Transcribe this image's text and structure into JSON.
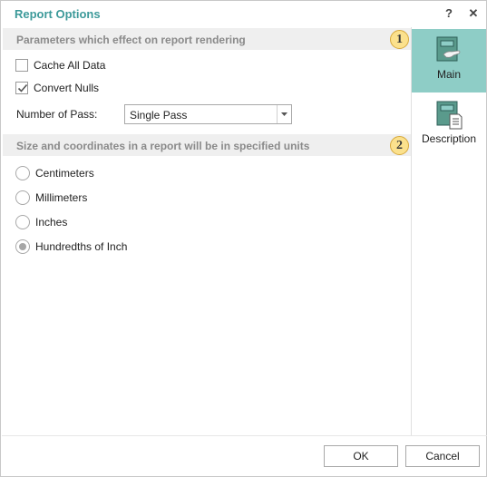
{
  "window": {
    "title": "Report Options",
    "help_label": "?",
    "close_label": "✕"
  },
  "sections": [
    {
      "label": "Parameters which effect on report rendering",
      "badge": "1"
    },
    {
      "label": "Size and coordinates in a report will be in specified units",
      "badge": "2"
    }
  ],
  "options": {
    "cache_all_data": {
      "label": "Cache All Data",
      "checked": false
    },
    "convert_nulls": {
      "label": "Convert Nulls",
      "checked": true
    },
    "number_of_pass": {
      "label": "Number of Pass:",
      "value": "Single Pass"
    }
  },
  "units": [
    {
      "label": "Centimeters",
      "selected": false
    },
    {
      "label": "Millimeters",
      "selected": false
    },
    {
      "label": "Inches",
      "selected": false
    },
    {
      "label": "Hundredths of Inch",
      "selected": true
    }
  ],
  "side_nav": [
    {
      "label": "Main",
      "icon": "main-page-icon",
      "active": true
    },
    {
      "label": "Description",
      "icon": "description-page-icon",
      "active": false
    }
  ],
  "footer": {
    "ok_label": "OK",
    "cancel_label": "Cancel"
  },
  "colors": {
    "title": "#3d9a9a",
    "active_nav": "#8ecdc6",
    "badge": "#fbe18d"
  }
}
